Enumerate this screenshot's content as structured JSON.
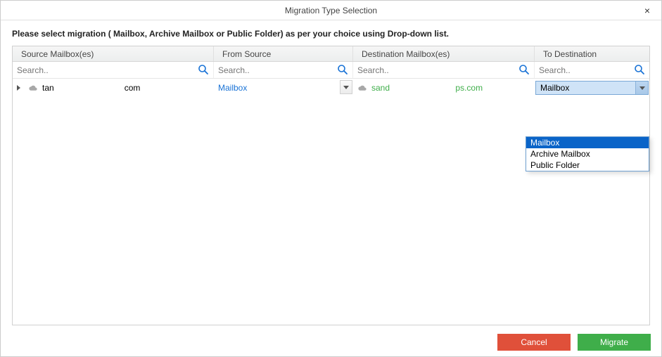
{
  "window": {
    "title": "Migration Type Selection",
    "close_label": "×"
  },
  "instruction": "Please select migration ( Mailbox, Archive Mailbox or Public Folder) as per your choice using Drop-down list.",
  "columns": {
    "source_mailboxes": "Source Mailbox(es)",
    "from_source": "From Source",
    "destination_mailboxes": "Destination Mailbox(es)",
    "to_destination": "To Destination"
  },
  "search": {
    "placeholder": "Search.."
  },
  "row": {
    "source_prefix": "tan",
    "source_suffix": "com",
    "from_source_value": "Mailbox",
    "dest_prefix": "sand",
    "dest_suffix": "ps.com",
    "to_destination_value": "Mailbox"
  },
  "dropdown": {
    "options": [
      "Mailbox",
      "Archive Mailbox",
      "Public Folder"
    ],
    "selected_index": 0
  },
  "buttons": {
    "cancel": "Cancel",
    "migrate": "Migrate"
  }
}
